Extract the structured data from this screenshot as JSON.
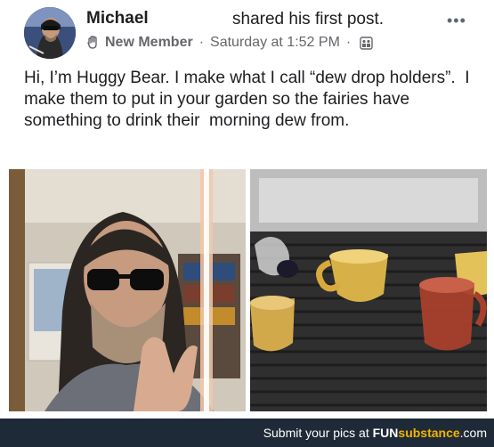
{
  "post": {
    "author": "Michael",
    "action": "shared his first post.",
    "badge": "New Member",
    "timestamp": "Saturday at 1:52 PM",
    "meta_sep": "·",
    "more_label": "•••",
    "text": "Hi, I’m Huggy Bear. I make what I call “dew drop holders”.  I make them to put in your garden so the fairies have something to drink their  morning dew from.",
    "icons": {
      "badge_icon": "wave-hand-icon",
      "privacy_icon": "group-privacy-icon",
      "more_icon": "more-options-icon"
    }
  },
  "footer": {
    "prefix": "Submit your pics at ",
    "brand_fun": "FUN",
    "brand_sub": "substance",
    "brand_com": ".com"
  },
  "colors": {
    "text": "#1c1e21",
    "secondary_text": "#65676b",
    "footer_bg": "#1f2a38",
    "footer_accent": "#f2b400"
  }
}
